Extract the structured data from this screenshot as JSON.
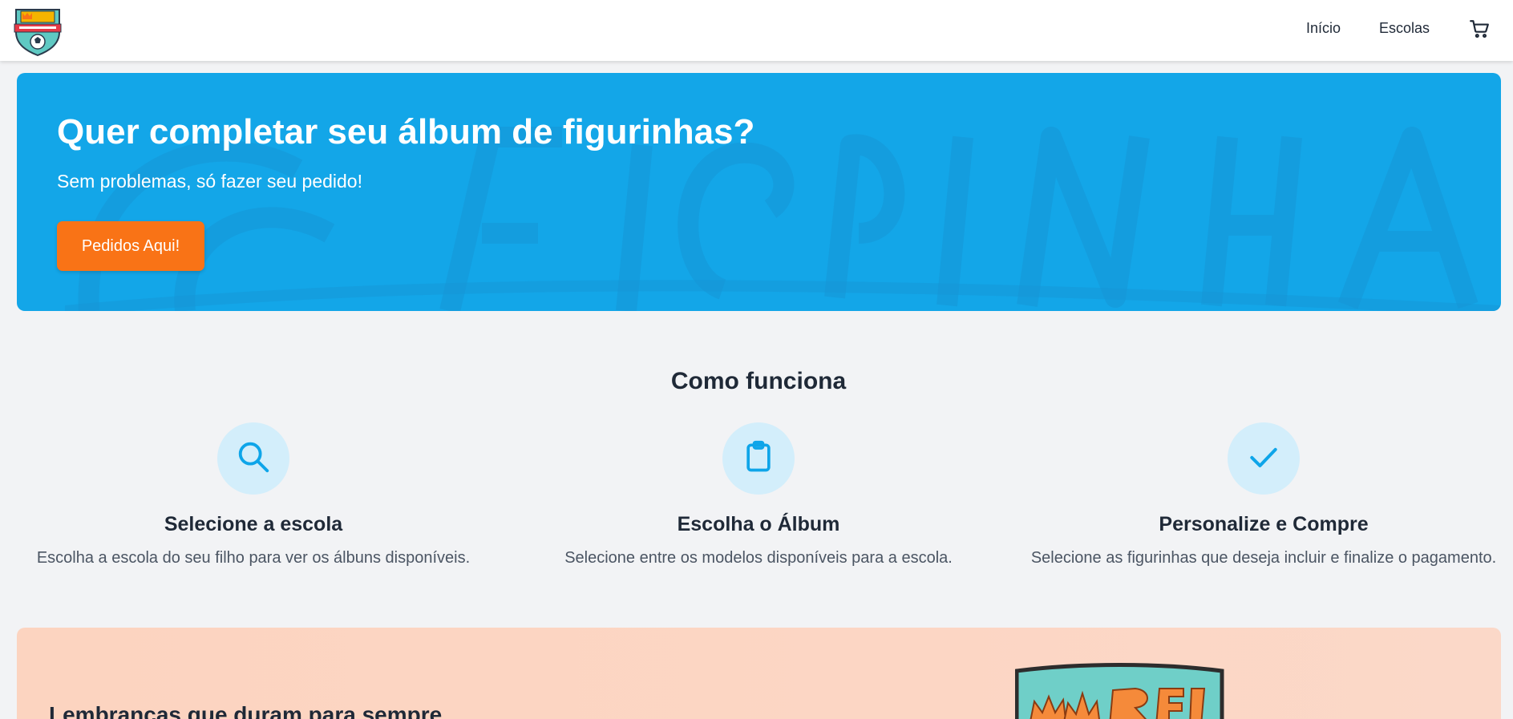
{
  "header": {
    "logo_alt": "Ô Rei das Figurinhas",
    "nav": {
      "inicio": "Início",
      "escolas": "Escolas"
    },
    "cart_icon": "cart-icon"
  },
  "hero": {
    "title": "Quer completar seu álbum de figurinhas?",
    "subtitle": "Sem problemas, só fazer seu pedido!",
    "button_label": "Pedidos Aqui!",
    "background_color": "#13a6e8",
    "button_color": "#f97316"
  },
  "how_it_works": {
    "title": "Como funciona",
    "steps": [
      {
        "icon": "search-icon",
        "title": "Selecione a escola",
        "description": "Escolha a escola do seu filho para ver os álbuns disponíveis."
      },
      {
        "icon": "clipboard-icon",
        "title": "Escolha o Álbum",
        "description": "Selecione entre os modelos disponíveis para a escola."
      },
      {
        "icon": "check-icon",
        "title": "Personalize e Compre",
        "description": "Selecione as figurinhas que deseja incluir e finalize o pagamento."
      }
    ]
  },
  "promo": {
    "title": "Lembranças que duram para sempre"
  }
}
